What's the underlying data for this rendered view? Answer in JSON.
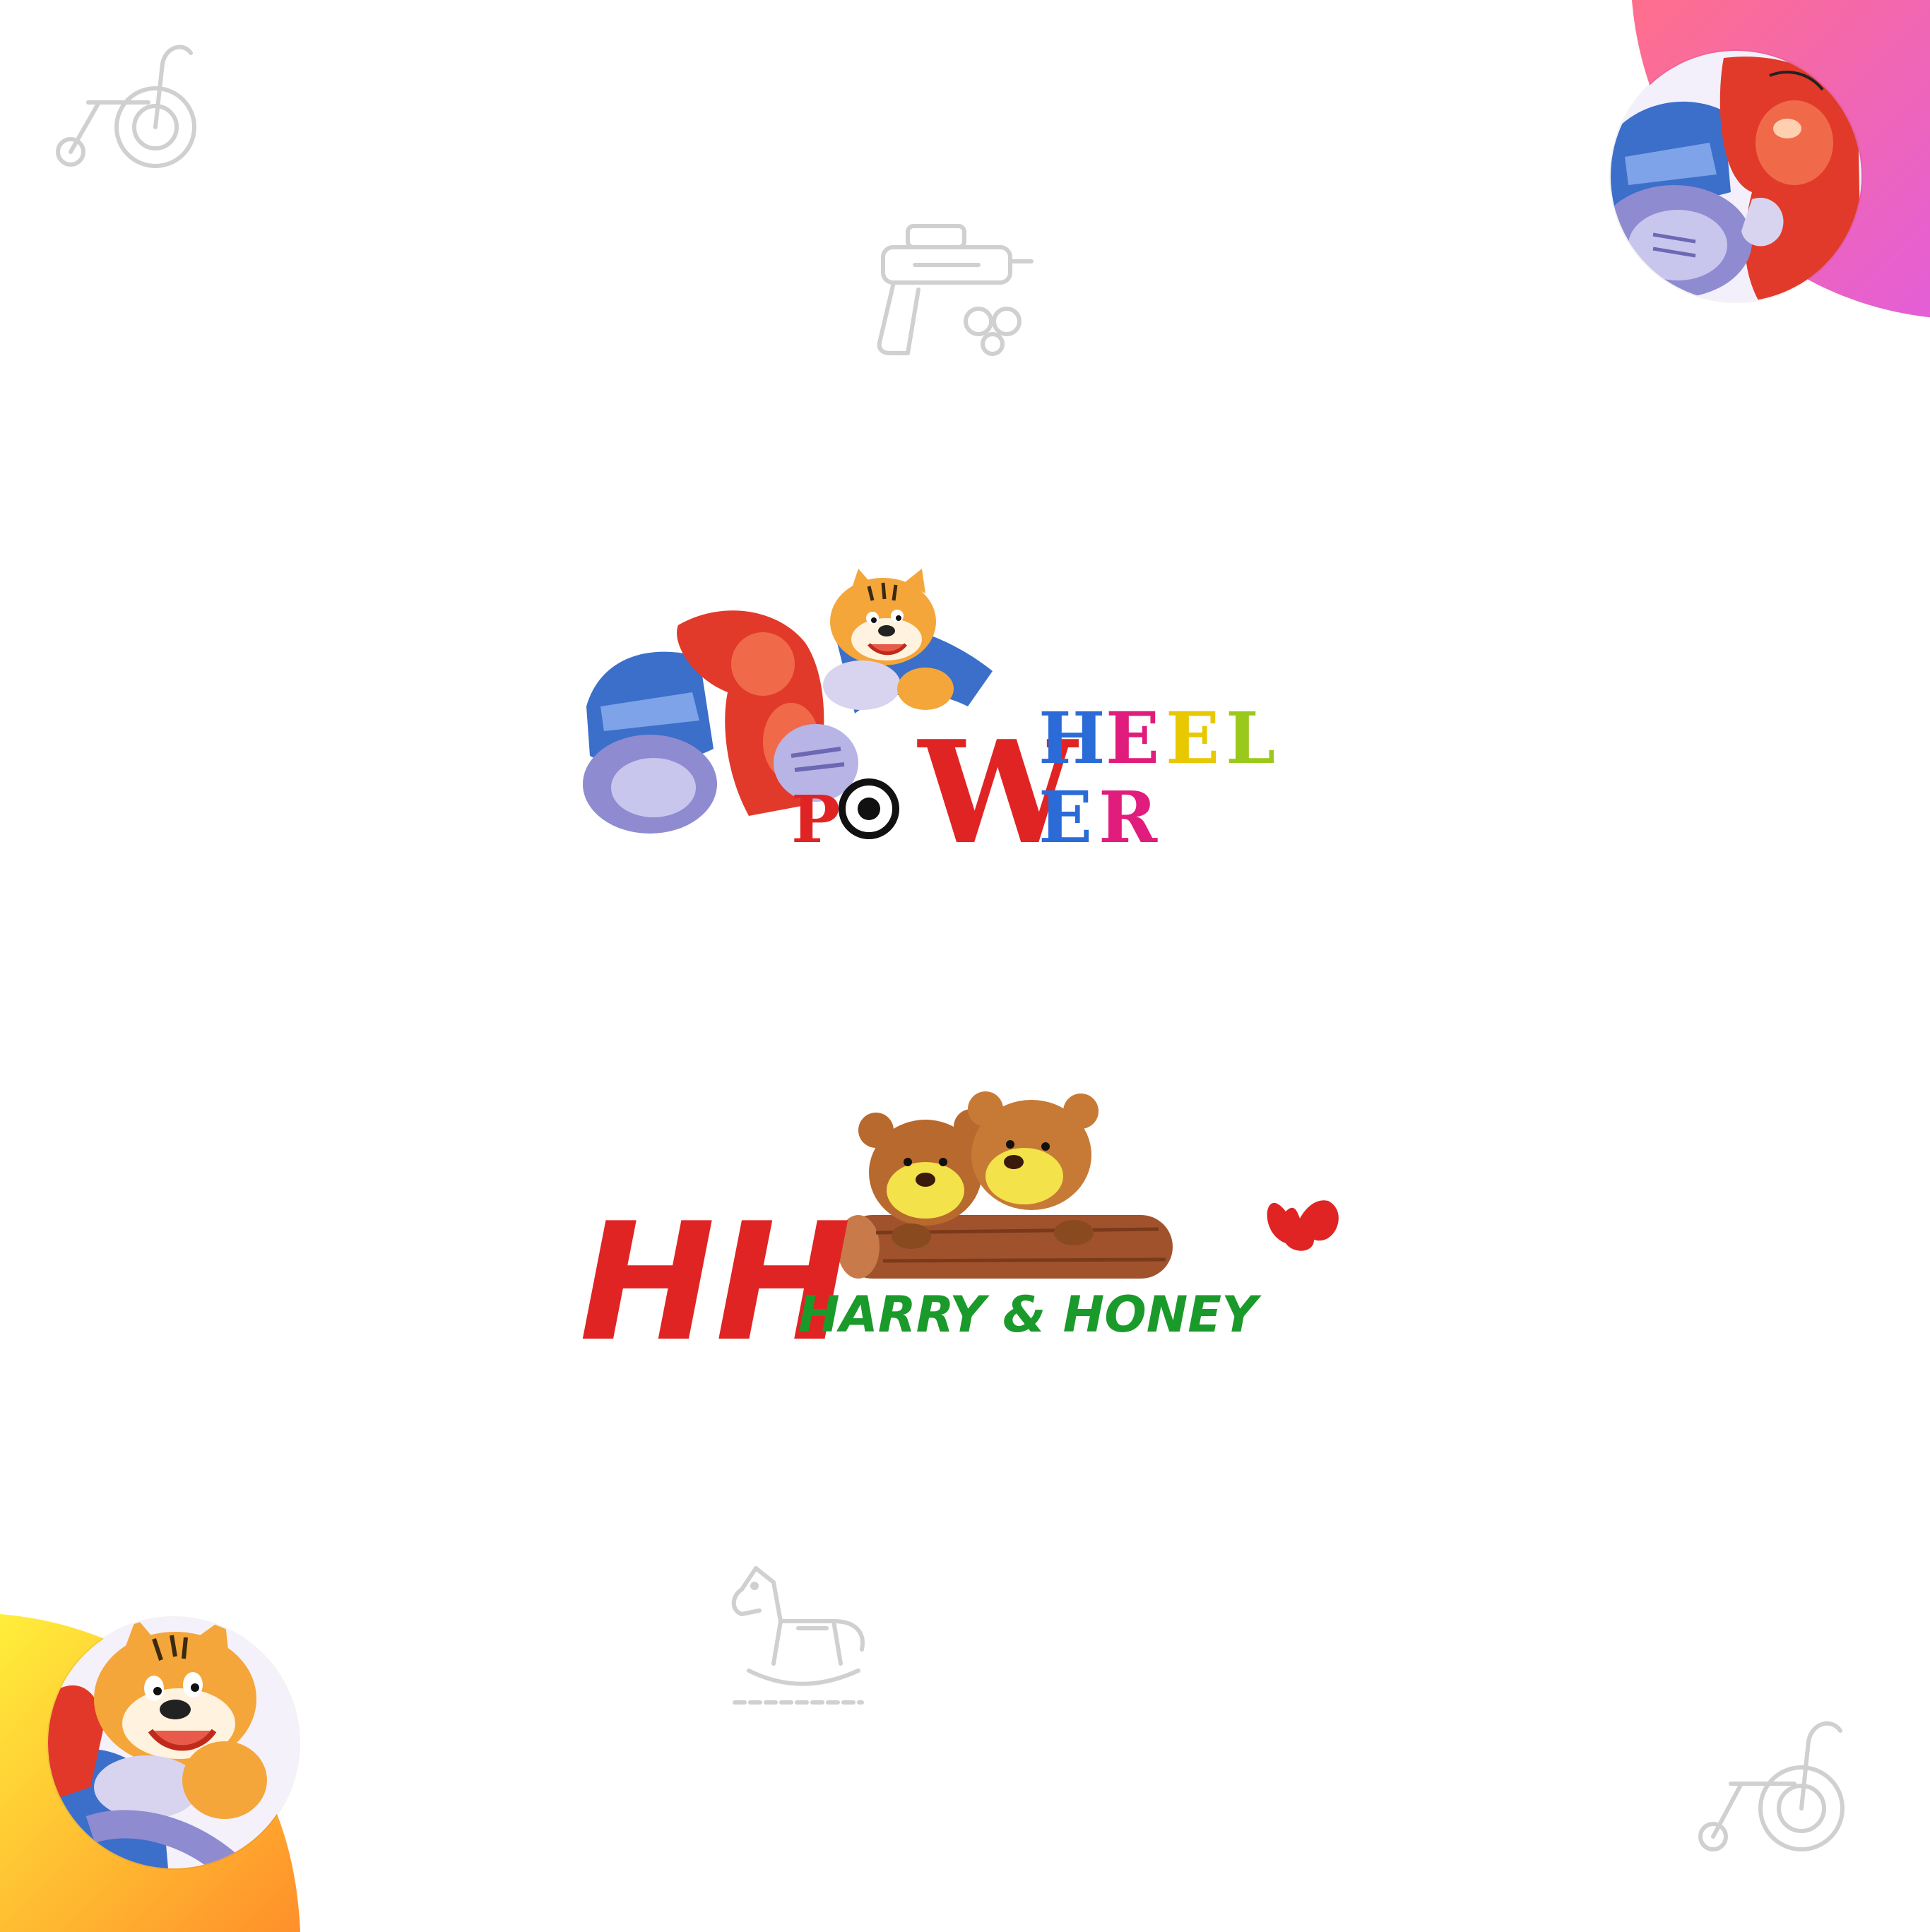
{
  "colors": {
    "background": "#ffffff",
    "blob_top_right": [
      "#ff6b8b",
      "#e45cd6"
    ],
    "blob_bottom_left": [
      "#ffe93a",
      "#ff8a2a"
    ],
    "icon_stroke": "#d0d0d0",
    "hh_red": "#e02424",
    "hh_green": "#1a9a2a",
    "pw_red": "#e02424",
    "pw_blue": "#2b6bd8",
    "pw_pink": "#e01c7c",
    "pw_yellow": "#e8c800",
    "pw_green": "#9ac91c"
  },
  "icons": {
    "tricycle_top_left": "tricycle-icon",
    "water_gun": "water-gun-icon",
    "rocking_horse": "rocking-horse-icon",
    "tricycle_bottom_right": "tricycle-icon"
  },
  "logos": {
    "power_wheel": {
      "line1": [
        "H",
        "E",
        "E",
        "L"
      ],
      "line2_left": [
        "P",
        "O"
      ],
      "big_letter": "W",
      "line2_right": [
        "E",
        "R"
      ]
    },
    "harry_honey": {
      "monogram": "HH",
      "name": "HARRY & HONEY"
    }
  }
}
